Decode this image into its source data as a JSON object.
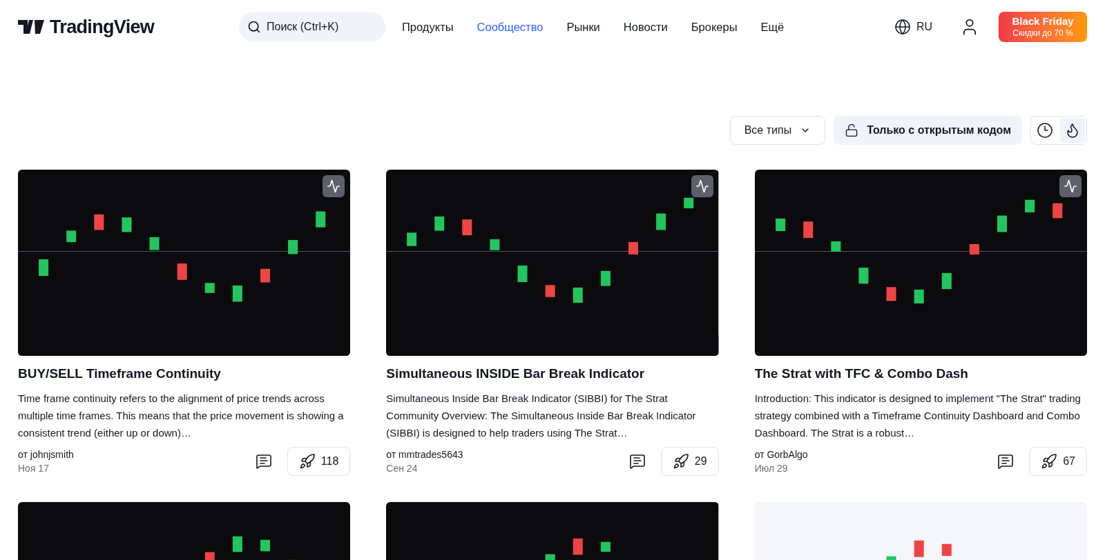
{
  "header": {
    "logo": "TradingView",
    "search": {
      "placeholder": "Поиск (Ctrl+K)"
    },
    "nav": [
      {
        "label": "Продукты",
        "selected": false
      },
      {
        "label": "Сообщество",
        "selected": true
      },
      {
        "label": "Рынки",
        "selected": false
      },
      {
        "label": "Новости",
        "selected": false
      },
      {
        "label": "Брокеры",
        "selected": false
      },
      {
        "label": "Ещё",
        "selected": false
      }
    ],
    "language": "RU",
    "promo": {
      "title": "Black Friday",
      "subtitle": "Скидки до 70 %"
    }
  },
  "filters": {
    "type_select": "Все типы",
    "open_source": "Только с открытым кодом",
    "sort": [
      {
        "kind": "clock",
        "selected": false
      },
      {
        "kind": "flame",
        "selected": true
      }
    ]
  },
  "cards": [
    {
      "title": "BUY/SELL Timeframe Continuity",
      "description": "Time frame continuity refers to the alignment of price trends across multiple time frames. This means that the price movement is showing a consistent trend (either up or down)…",
      "author": "от johnjsmith",
      "date": "Ноя 17",
      "boosts": "118"
    },
    {
      "title": "Simultaneous INSIDE Bar Break Indicator",
      "description": "Simultaneous Inside Bar Break Indicator (SIBBI) for The Strat Community Overview: The Simultaneous Inside Bar Break Indicator (SIBBI) is designed to help traders using The Strat…",
      "author": "от mmtrades5643",
      "date": "Сен 24",
      "boosts": "29"
    },
    {
      "title": "The Strat with TFC & Combo Dash",
      "description": "Introduction: This indicator is designed to implement \"The Strat\" trading strategy combined with a Timeframe Continuity Dashboard and Combo Dashboard. The Strat is a robust…",
      "author": "от GorbAlgo",
      "date": "Июл 29",
      "boosts": "67"
    }
  ]
}
